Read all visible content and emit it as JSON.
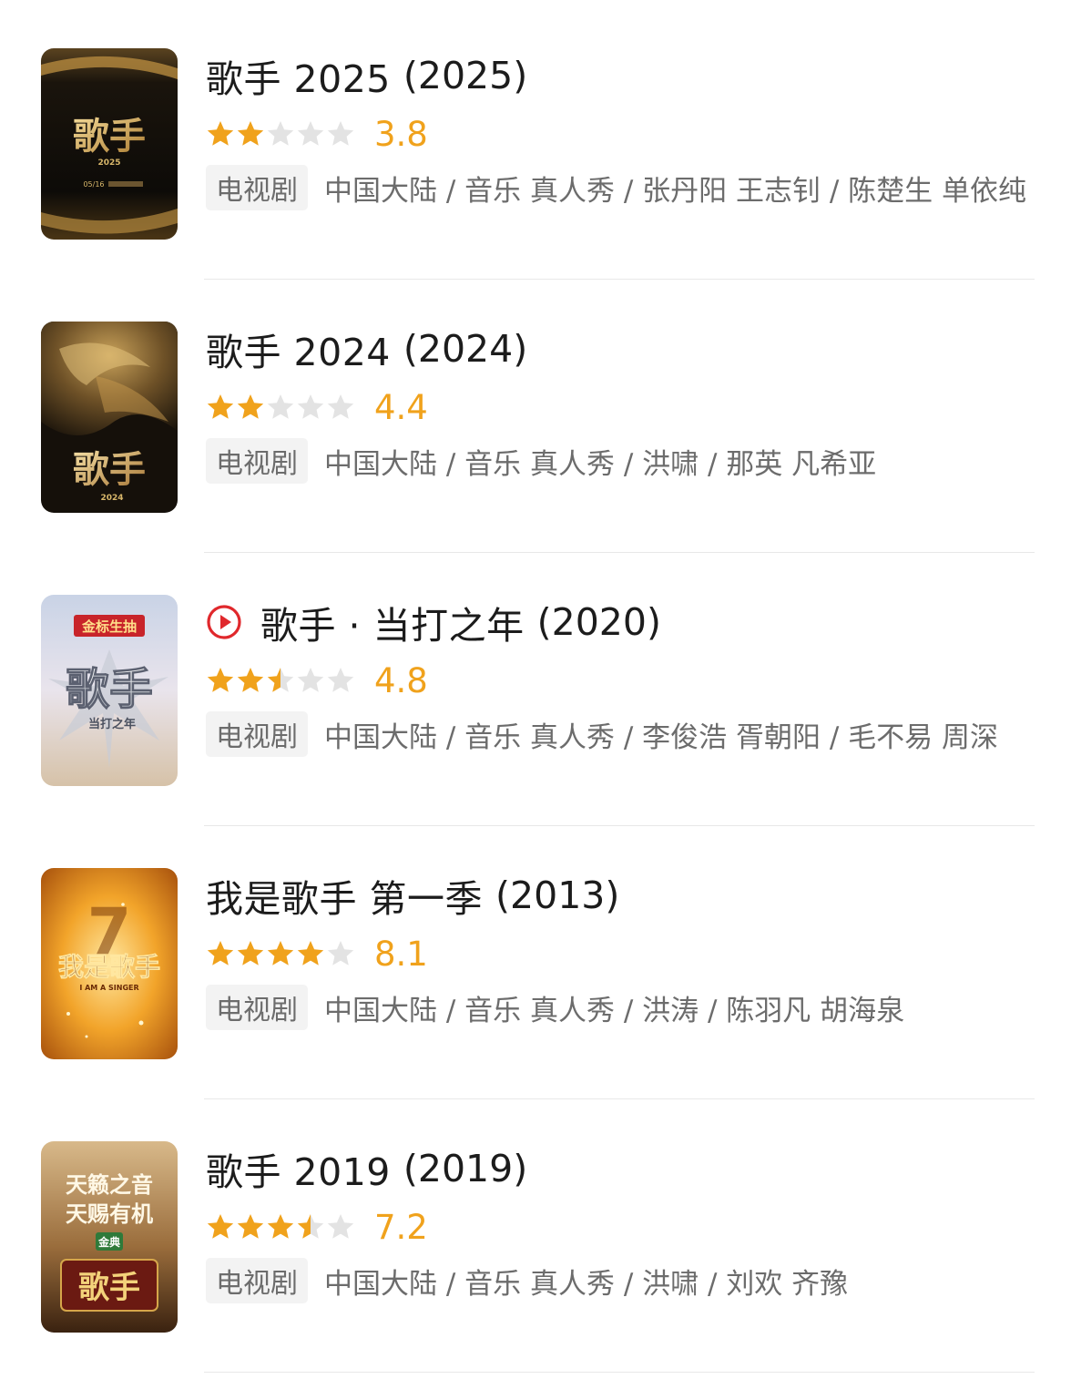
{
  "items": [
    {
      "title": "歌手 2025",
      "year": "(2025)",
      "has_play_icon": false,
      "stars": 2,
      "score": "3.8",
      "tag": "电视剧",
      "info": "中国大陆 / 音乐 真人秀 / 张丹阳 王志钊 / 陈楚生 单依纯",
      "poster": {
        "text": "歌手",
        "sub": "2025",
        "date": "05/16",
        "theme": "dark-gold"
      }
    },
    {
      "title": "歌手 2024",
      "year": "(2024)",
      "has_play_icon": false,
      "stars": 2,
      "score": "4.4",
      "tag": "电视剧",
      "info": "中国大陆 / 音乐 真人秀 / 洪啸 / 那英 凡希亚",
      "poster": {
        "text": "歌手",
        "sub": "2024",
        "theme": "gold-swirl"
      }
    },
    {
      "title": "歌手 · 当打之年",
      "year": "(2020)",
      "has_play_icon": true,
      "stars": 2.5,
      "score": "4.8",
      "tag": "电视剧",
      "info": "中国大陆 / 音乐 真人秀 / 李俊浩 胥朝阳 / 毛不易 周深",
      "poster": {
        "text": "歌手",
        "sub": "当打之年",
        "banner": "金标生抽",
        "theme": "silver-red"
      }
    },
    {
      "title": "我是歌手 第一季",
      "year": "(2013)",
      "has_play_icon": false,
      "stars": 4,
      "score": "8.1",
      "tag": "电视剧",
      "info": "中国大陆 / 音乐 真人秀 / 洪涛 / 陈羽凡 胡海泉",
      "poster": {
        "text": "我是歌手",
        "sub": "I AM A SINGER",
        "theme": "orange-gold"
      }
    },
    {
      "title": "歌手 2019",
      "year": "(2019)",
      "has_play_icon": false,
      "stars": 3.5,
      "score": "7.2",
      "tag": "电视剧",
      "info": "中国大陆 / 音乐 真人秀 / 洪啸 / 刘欢 齐豫",
      "poster": {
        "text": "歌手",
        "line1": "天籁之音",
        "line2": "天赐有机",
        "badge": "金典",
        "theme": "brown-gold"
      }
    }
  ],
  "colors": {
    "star_on": "#f0a21c",
    "star_off": "#e3e3e3",
    "score": "#f0a21c",
    "play": "#e0282c"
  },
  "icons": {
    "play": "play-circle-icon",
    "star": "star-icon"
  }
}
